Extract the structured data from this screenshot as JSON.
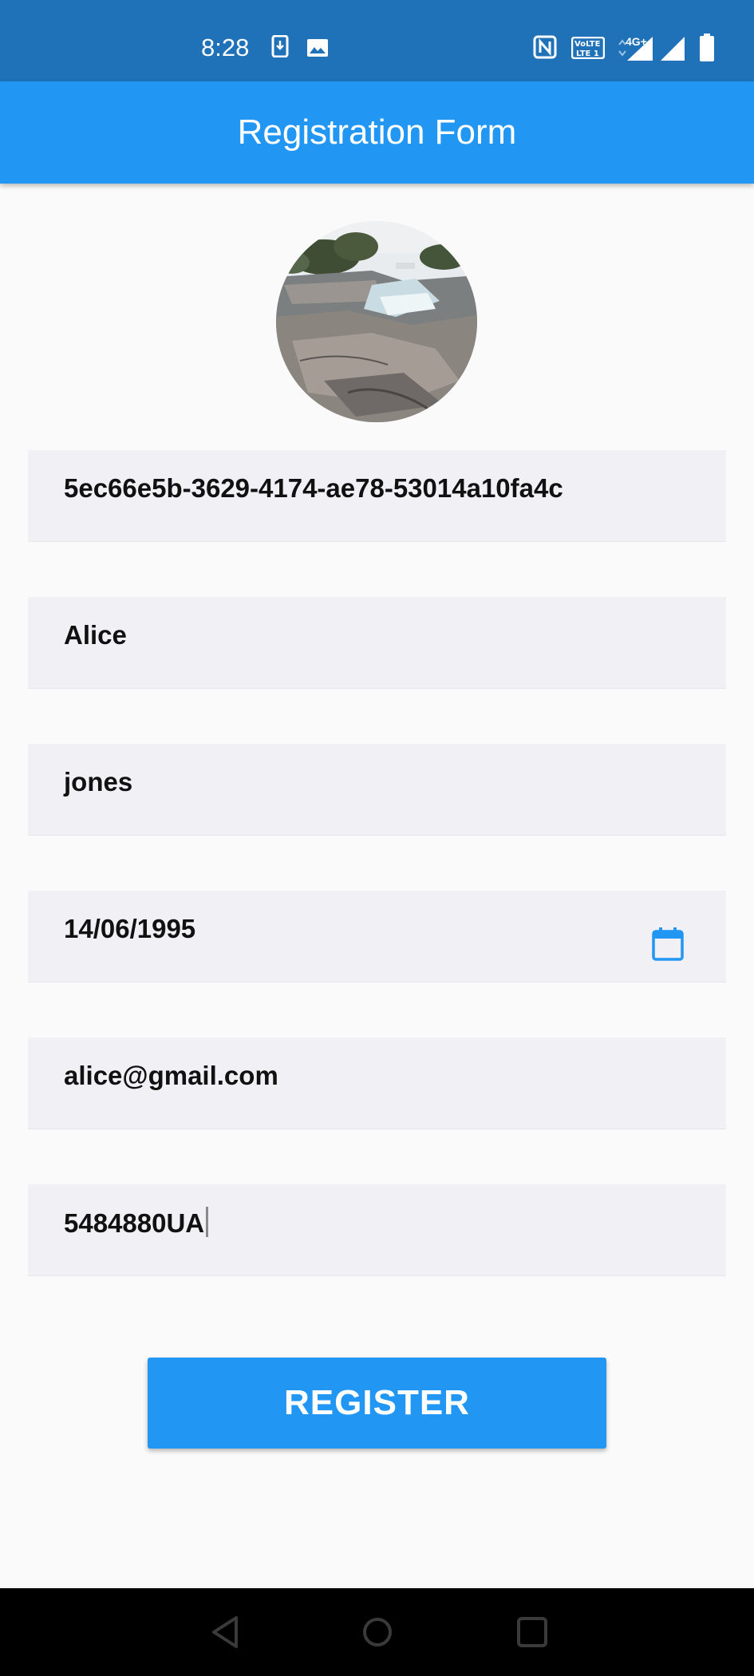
{
  "status_bar": {
    "time": "8:28",
    "network_label": "4G+",
    "left_icons": [
      "download-icon",
      "image-icon"
    ],
    "right_icons": [
      "nfc-icon",
      "volte-icon",
      "signal-4g-icon",
      "signal-icon",
      "battery-icon"
    ]
  },
  "app_bar": {
    "title": "Registration Form"
  },
  "form": {
    "id_value": "5ec66e5b-3629-4174-ae78-53014a10fa4c",
    "first_name_value": "Alice",
    "last_name_value": "jones",
    "birthdate_value": "14/06/1995",
    "email_value": "alice@gmail.com",
    "document_value": "5484880UA",
    "register_label": "REGISTER"
  },
  "colors": {
    "status_bar": "#1f71b8",
    "app_bar": "#2196f3",
    "button": "#2196f3",
    "field_background": "#f1f1f5",
    "page_background": "#fafafa"
  },
  "nav_bar": {
    "icons": [
      "back-icon",
      "home-icon",
      "recents-icon"
    ]
  }
}
